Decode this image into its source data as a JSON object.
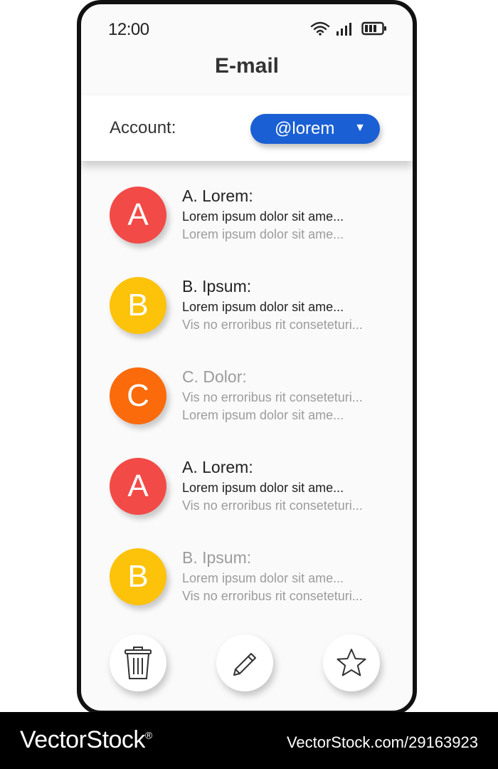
{
  "status": {
    "time": "12:00",
    "wifi_icon": "wifi-icon",
    "signal_icon": "signal-icon",
    "battery_icon": "battery-icon"
  },
  "app": {
    "title": "E-mail"
  },
  "account": {
    "label": "Account:",
    "selected": "@lorem",
    "arrow": "▼"
  },
  "mails": [
    {
      "initial": "A",
      "color": "#f24a46",
      "sender": "A. Lorem:",
      "line1": "Lorem   ipsum   dolor   sit   ame...",
      "line2": "Lorem   ipsum   dolor   sit   ame...",
      "read": false,
      "line2_dim": true
    },
    {
      "initial": "B",
      "color": "#fdc20a",
      "sender": "B. Ipsum:",
      "line1": "Lorem   ipsum   dolor   sit   ame...",
      "line2": "Vis no erroribus rit conseteturi...",
      "read": false,
      "line2_dim": true
    },
    {
      "initial": "C",
      "color": "#fb6a0b",
      "sender": "C. Dolor:",
      "line1": "Vis no erroribus rit conseteturi...",
      "line2": "Lorem   ipsum   dolor   sit   ame...",
      "read": true,
      "line2_dim": true
    },
    {
      "initial": "A",
      "color": "#f24a46",
      "sender": "A. Lorem:",
      "line1": "Lorem   ipsum   dolor   sit   ame...",
      "line2": "Vis no erroribus rit conseteturi...",
      "read": false,
      "line2_dim": true
    },
    {
      "initial": "B",
      "color": "#fdc20a",
      "sender": "B. Ipsum:",
      "line1": "Lorem   ipsum   dolor   sit   ame...",
      "line2": "Vis no erroribus rit conseteturi...",
      "read": true,
      "line2_dim": true
    }
  ],
  "actions": {
    "delete_icon": "trash-icon",
    "compose_icon": "pencil-icon",
    "favorite_icon": "star-icon"
  },
  "footer": {
    "brand": "VectorStock",
    "reg": "®",
    "url": "VectorStock.com/29163923"
  }
}
